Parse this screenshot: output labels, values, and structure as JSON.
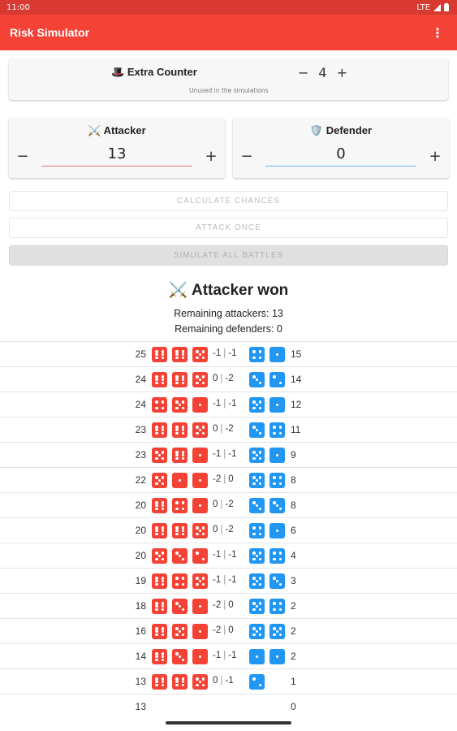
{
  "status": {
    "time": "11:00",
    "network": "LTE"
  },
  "app": {
    "title": "Risk Simulator",
    "menu_icon": "more-vert-icon"
  },
  "extra_counter": {
    "icon": "🎩",
    "label": "Extra Counter",
    "subtitle": "Unused in the simulations",
    "value": "4",
    "minus": "−",
    "plus": "+"
  },
  "attacker": {
    "icon": "⚔️",
    "label": "Attacker",
    "value": "13",
    "minus": "−",
    "plus": "+"
  },
  "defender": {
    "icon": "🛡️",
    "label": "Defender",
    "value": "0",
    "minus": "−",
    "plus": "+"
  },
  "buttons": {
    "calculate": "CALCULATE CHANCES",
    "attack_once": "ATTACK ONCE",
    "simulate": "SIMULATE ALL BATTLES"
  },
  "result": {
    "icon": "⚔️",
    "title": "Attacker won",
    "remaining_attackers": "Remaining attackers: 13",
    "remaining_defenders": "Remaining defenders: 0"
  },
  "colors": {
    "attacker": "#f44336",
    "defender": "#2196f3",
    "app_bar": "#f44336"
  },
  "battles": [
    {
      "a": "25",
      "ad": [
        6,
        6,
        5
      ],
      "da": "-1",
      "dd": "-1",
      "dv": [
        4,
        1
      ],
      "d": "15"
    },
    {
      "a": "24",
      "ad": [
        6,
        6,
        5
      ],
      "da": "0",
      "dd": "-2",
      "dv": [
        3,
        2
      ],
      "d": "14"
    },
    {
      "a": "24",
      "ad": [
        4,
        5,
        1
      ],
      "da": "-1",
      "dd": "-1",
      "dv": [
        5,
        1
      ],
      "d": "12"
    },
    {
      "a": "23",
      "ad": [
        6,
        6,
        5
      ],
      "da": "0",
      "dd": "-2",
      "dv": [
        3,
        4
      ],
      "d": "11"
    },
    {
      "a": "23",
      "ad": [
        5,
        6,
        1
      ],
      "da": "-1",
      "dd": "-1",
      "dv": [
        5,
        1
      ],
      "d": "9"
    },
    {
      "a": "22",
      "ad": [
        5,
        1,
        1
      ],
      "da": "-2",
      "dd": "0",
      "dv": [
        5,
        4
      ],
      "d": "8"
    },
    {
      "a": "20",
      "ad": [
        6,
        4,
        1
      ],
      "da": "0",
      "dd": "-2",
      "dv": [
        3,
        3
      ],
      "d": "8"
    },
    {
      "a": "20",
      "ad": [
        6,
        6,
        5
      ],
      "da": "0",
      "dd": "-2",
      "dv": [
        4,
        1
      ],
      "d": "6"
    },
    {
      "a": "20",
      "ad": [
        5,
        3,
        2
      ],
      "da": "-1",
      "dd": "-1",
      "dv": [
        5,
        4
      ],
      "d": "4"
    },
    {
      "a": "19",
      "ad": [
        6,
        4,
        5
      ],
      "da": "-1",
      "dd": "-1",
      "dv": [
        5,
        3
      ],
      "d": "3"
    },
    {
      "a": "18",
      "ad": [
        6,
        3,
        1
      ],
      "da": "-2",
      "dd": "0",
      "dv": [
        5,
        4
      ],
      "d": "2"
    },
    {
      "a": "16",
      "ad": [
        6,
        5,
        1
      ],
      "da": "-2",
      "dd": "0",
      "dv": [
        5,
        5
      ],
      "d": "2"
    },
    {
      "a": "14",
      "ad": [
        6,
        3,
        1
      ],
      "da": "-1",
      "dd": "-1",
      "dv": [
        1,
        1
      ],
      "d": "2"
    },
    {
      "a": "13",
      "ad": [
        6,
        6,
        5
      ],
      "da": "0",
      "dd": "-1",
      "dv": [
        2
      ],
      "d": "1"
    },
    {
      "a": "13",
      "ad": [],
      "da": "",
      "dd": "",
      "dv": [],
      "d": "0"
    }
  ]
}
